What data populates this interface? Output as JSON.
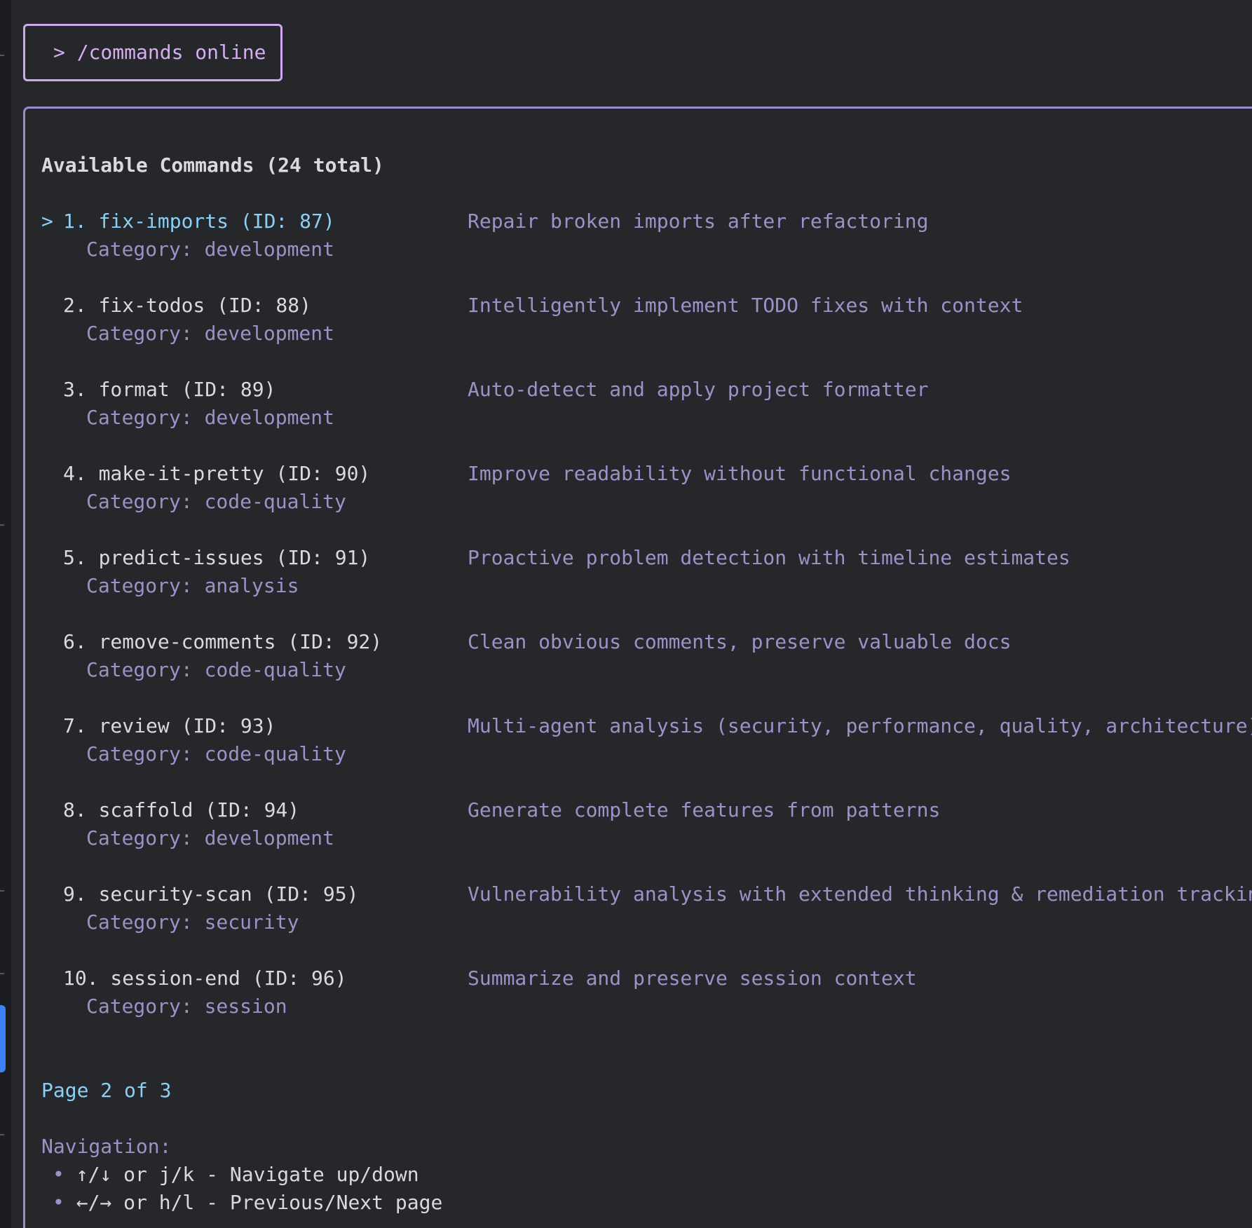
{
  "command_input": {
    "prompt": ">",
    "text": "/commands online"
  },
  "header": {
    "title": "Available Commands (24 total)"
  },
  "commands": [
    {
      "selected": true,
      "marker": "> ",
      "label": "1. fix-imports (ID: 87)",
      "category": "Category: development",
      "description": "Repair broken imports after refactoring"
    },
    {
      "selected": false,
      "marker": "",
      "label": "2. fix-todos (ID: 88)",
      "category": "Category: development",
      "description": "Intelligently implement TODO fixes with context"
    },
    {
      "selected": false,
      "marker": "",
      "label": "3. format (ID: 89)",
      "category": "Category: development",
      "description": "Auto-detect and apply project formatter"
    },
    {
      "selected": false,
      "marker": "",
      "label": "4. make-it-pretty (ID: 90)",
      "category": "Category: code-quality",
      "description": "Improve readability without functional changes"
    },
    {
      "selected": false,
      "marker": "",
      "label": "5. predict-issues (ID: 91)",
      "category": "Category: analysis",
      "description": "Proactive problem detection with timeline estimates"
    },
    {
      "selected": false,
      "marker": "",
      "label": "6. remove-comments (ID: 92)",
      "category": "Category: code-quality",
      "description": "Clean obvious comments, preserve valuable docs"
    },
    {
      "selected": false,
      "marker": "",
      "label": "7. review (ID: 93)",
      "category": "Category: code-quality",
      "description": "Multi-agent analysis (security, performance, quality, architecture)"
    },
    {
      "selected": false,
      "marker": "",
      "label": "8. scaffold (ID: 94)",
      "category": "Category: development",
      "description": "Generate complete features from patterns"
    },
    {
      "selected": false,
      "marker": "",
      "label": "9. security-scan (ID: 95)",
      "category": "Category: security",
      "description": "Vulnerability analysis with extended thinking & remediation tracking"
    },
    {
      "selected": false,
      "marker": "",
      "label": "10. session-end (ID: 96)",
      "category": "Category: session",
      "description": "Summarize and preserve session context"
    }
  ],
  "pagination": {
    "text": "Page 2 of 3"
  },
  "navigation": {
    "title": "Navigation:",
    "items": [
      {
        "bullet": "•",
        "text": "↑/↓ or j/k - Navigate up/down"
      },
      {
        "bullet": "•",
        "text": "←/→ or h/l - Previous/Next page"
      }
    ]
  },
  "colors": {
    "background": "#26272b",
    "accent_border": "#cfa8ee",
    "panel_border": "#9b8ccb",
    "selected": "#8ccff5",
    "muted": "#9d92c8",
    "text": "#d9d9df",
    "gutter_accent": "#3b82f6"
  }
}
